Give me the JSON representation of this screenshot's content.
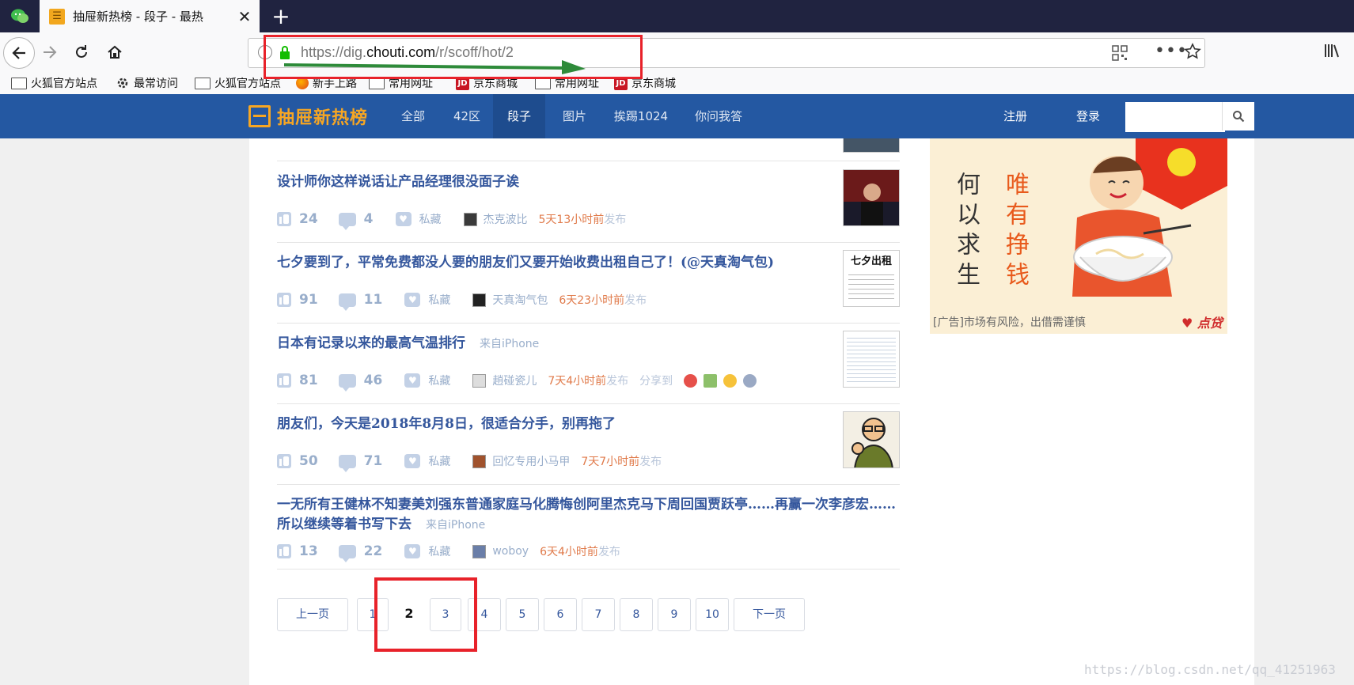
{
  "browser": {
    "tab_title": "抽屉新热榜 - 段子 - 最热",
    "url_prefix": "https://dig.",
    "url_domain": "chouti.com",
    "url_path": "/r/scoff/hot/2",
    "bookmarks": [
      {
        "label": "火狐官方站点",
        "icon": "folder-icon"
      },
      {
        "label": "最常访问",
        "icon": "gear-icon"
      },
      {
        "label": "火狐官方站点",
        "icon": "folder-icon"
      },
      {
        "label": "新手上路",
        "icon": "firefox-icon"
      },
      {
        "label": "常用网址",
        "icon": "folder-icon"
      },
      {
        "label": "京东商城",
        "icon": "jd-icon"
      },
      {
        "label": "常用网址",
        "icon": "folder-icon"
      },
      {
        "label": "京东商城",
        "icon": "jd-icon"
      }
    ],
    "jd_icon_text": "JD"
  },
  "site": {
    "logo_text": "抽屉新热榜",
    "nav": [
      "全部",
      "42区",
      "段子",
      "图片",
      "挨踢1024",
      "你问我答"
    ],
    "active_nav": "段子",
    "register": "注册",
    "login": "登录",
    "search_placeholder": ""
  },
  "items": [
    {
      "title": "设计师你这样说话让产品经理很没面子诶",
      "source": "",
      "likes": "24",
      "comments": "4",
      "fav_label": "私藏",
      "user": "杰克波比",
      "time": "5天13小时前",
      "pub": "发布",
      "share": false
    },
    {
      "title": "七夕要到了，平常免费都没人要的朋友们又要开始收费出租自己了！(@天真淘气包)",
      "source": "",
      "likes": "91",
      "comments": "11",
      "fav_label": "私藏",
      "user": "天真淘气包",
      "time": "6天23小时前",
      "pub": "发布",
      "share": false,
      "thumb_text": "七夕出租"
    },
    {
      "title": "日本有记录以来的最高气温排行",
      "source": "来自iPhone",
      "likes": "81",
      "comments": "46",
      "fav_label": "私藏",
      "user": "趙碰瓷儿",
      "time": "7天4小时前",
      "pub": "发布",
      "share": true,
      "share_label": "分享到"
    },
    {
      "title": "朋友们，今天是2018年8月8日，很适合分手，别再拖了",
      "source": "",
      "likes": "50",
      "comments": "71",
      "fav_label": "私藏",
      "user": "回忆专用小马甲",
      "time": "7天7小时前",
      "pub": "发布",
      "share": false
    },
    {
      "title": "一无所有王健林不知妻美刘强东普通家庭马化腾悔创阿里杰克马下周回国贾跃亭……再赢一次李彦宏……所以继续等着书写下去",
      "source": "来自iPhone",
      "likes": "13",
      "comments": "22",
      "fav_label": "私藏",
      "user": "woboy",
      "time": "6天4小时前",
      "pub": "发布",
      "share": false
    }
  ],
  "pagination": {
    "prev": "上一页",
    "pages": [
      "1",
      "2",
      "3",
      "4",
      "5",
      "6",
      "7",
      "8",
      "9",
      "10"
    ],
    "current": "2",
    "next": "下一页"
  },
  "ad": {
    "left_text": "何以求生",
    "right_text": "唯有挣钱",
    "disclaimer": "[广告]市场有风险，出借需谨慎",
    "brand": "点贷"
  },
  "watermark": "https://blog.csdn.net/qq_41251963",
  "colors": {
    "header_bg": "#2458a2",
    "title_blue": "#35579d",
    "time_orange": "#e07a4a",
    "annotation_red": "#e8222a",
    "annotation_green": "#2e8b3a"
  }
}
